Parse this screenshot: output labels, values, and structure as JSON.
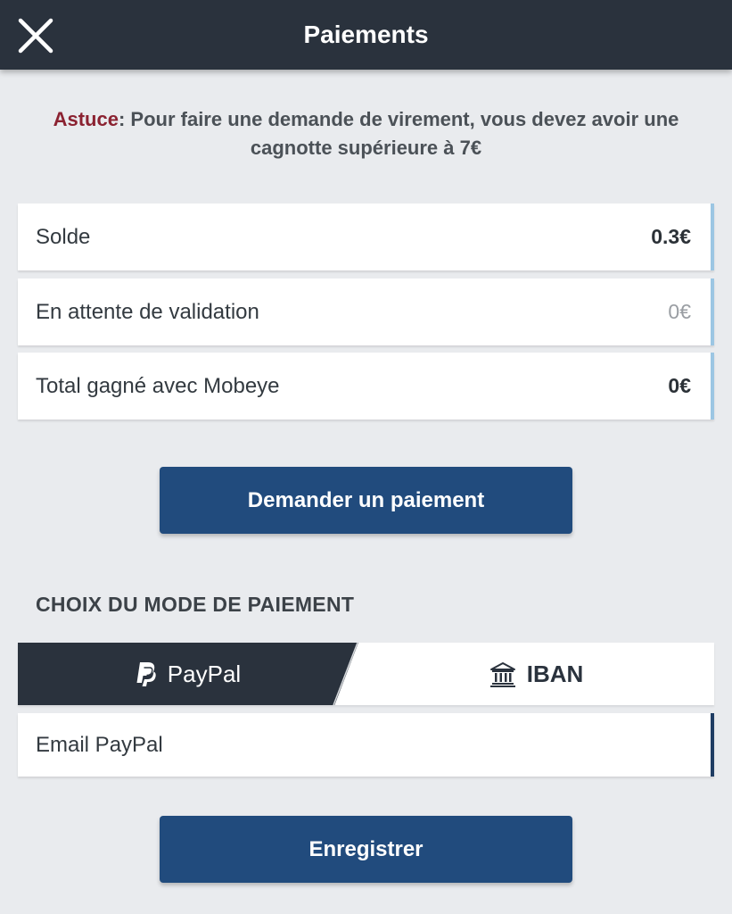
{
  "header": {
    "title": "Paiements",
    "close_icon": "close-icon"
  },
  "tip": {
    "label": "Astuce",
    "text": ": Pour faire une demande de virement, vous devez avoir une cagnotte supérieure à 7€"
  },
  "stats": [
    {
      "label": "Solde",
      "value": "0.3€"
    },
    {
      "label": "En attente de validation",
      "value": "0€"
    },
    {
      "label": "Total gagné avec Mobeye",
      "value": "0€"
    }
  ],
  "request_button": {
    "label": "Demander un paiement"
  },
  "payment_mode": {
    "title": "CHOIX DU MODE DE PAIEMENT",
    "tabs": [
      {
        "label": "PayPal",
        "icon": "paypal-icon",
        "selected": true
      },
      {
        "label": "IBAN",
        "icon": "bank-icon",
        "selected": false
      }
    ]
  },
  "email_field": {
    "placeholder": "Email PayPal",
    "value": ""
  },
  "save_button": {
    "label": "Enregistrer"
  },
  "colors": {
    "header_bg": "#2a323d",
    "accent_blue": "#214b7d",
    "tip_label": "#8b2231",
    "row_border": "#9cc6e3",
    "page_bg": "#e9ebee"
  }
}
